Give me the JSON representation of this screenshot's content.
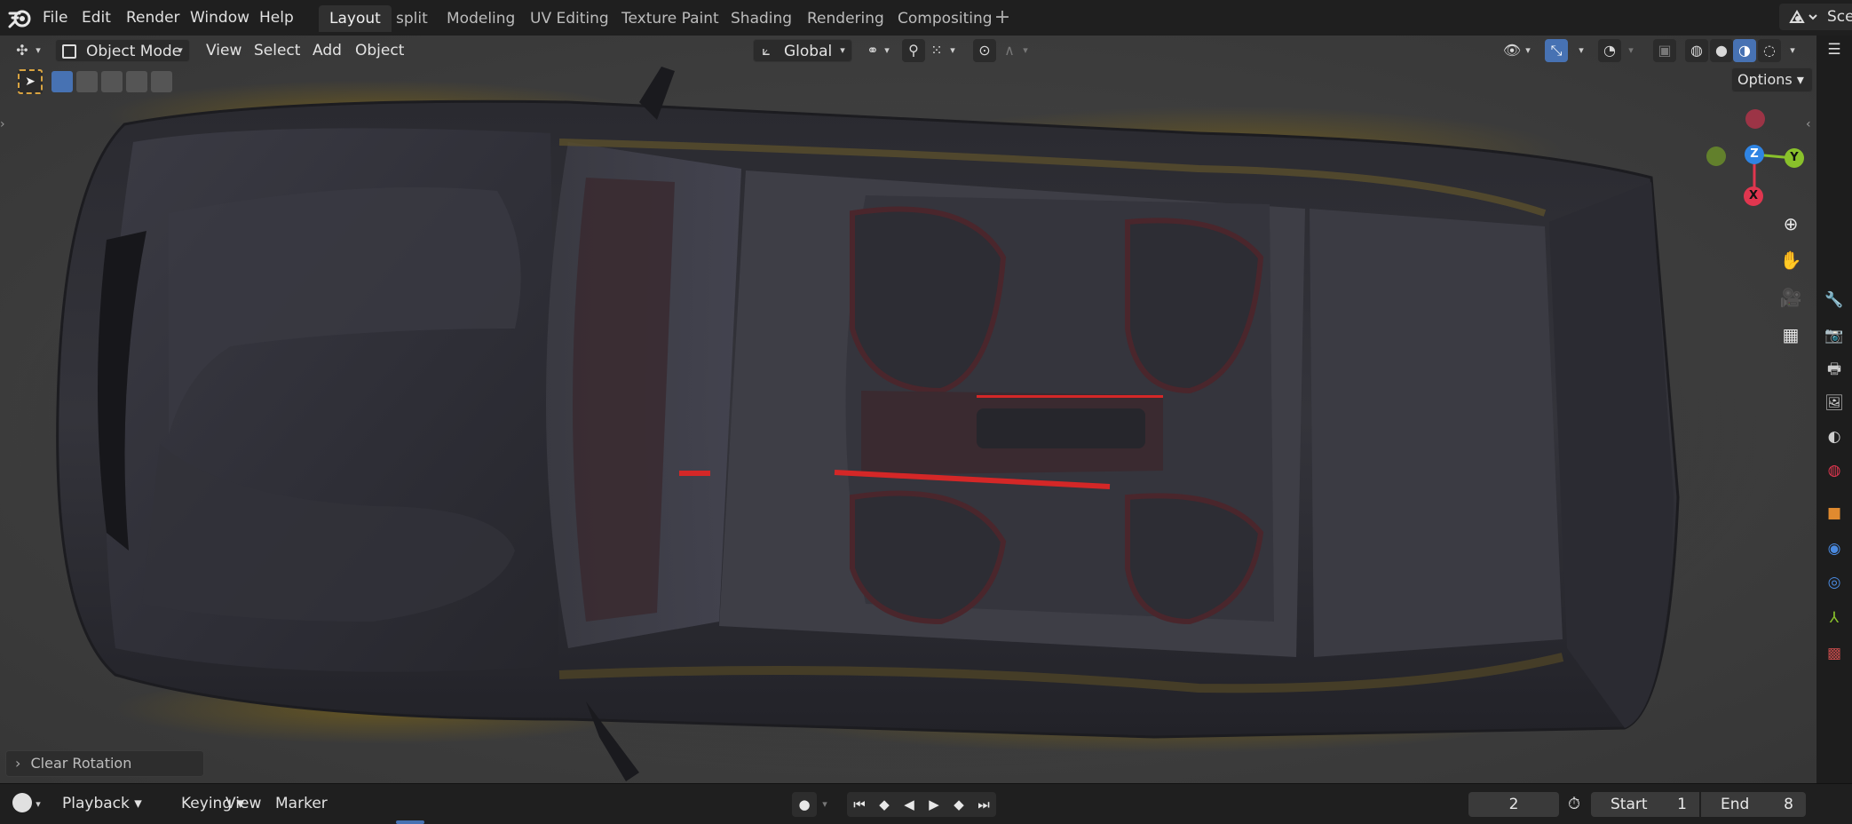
{
  "topbar": {
    "menus": [
      "File",
      "Edit",
      "Render",
      "Window",
      "Help"
    ],
    "workspaces": [
      "Layout",
      "split",
      "Modeling",
      "UV Editing",
      "Texture Paint",
      "Shading",
      "Rendering",
      "Compositing"
    ],
    "active_workspace": "Layout",
    "add_label": "+",
    "scene_label": "Sce"
  },
  "viewport_header": {
    "mode": "Object Mode",
    "menus": [
      "View",
      "Select",
      "Add",
      "Object"
    ],
    "transform_orientation": "Global",
    "options_label": "Options"
  },
  "gizmo": {
    "z": "Z",
    "y": "Y",
    "x": "X"
  },
  "operator_panel": {
    "label": "Clear Rotation"
  },
  "timeline": {
    "menus": [
      "Playback",
      "Keying",
      "View",
      "Marker"
    ],
    "current_frame": "2",
    "start_label": "Start",
    "start_value": "1",
    "end_label": "End",
    "end_value": "8"
  },
  "colors": {
    "accent": "#4772b3",
    "axis_x": "#e0364f",
    "axis_y": "#89c12b",
    "axis_z": "#2f84e3"
  },
  "icons": [
    "blender-logo-icon",
    "editor-type-icon",
    "object-mode-icon",
    "transform-orientation-icon",
    "pivot-icon",
    "snap-icon",
    "proportional-edit-icon",
    "visibility-icon",
    "gizmo-icon",
    "overlay-icon",
    "xray-icon",
    "wireframe-shading-icon",
    "solid-shading-icon",
    "material-shading-icon",
    "rendered-shading-icon",
    "zoom-icon",
    "pan-hand-icon",
    "camera-icon",
    "grid-icon",
    "tool-icon",
    "render-icon",
    "output-icon",
    "view-layer-icon",
    "scene-icon",
    "world-icon",
    "object-icon",
    "modifier-icon",
    "physics-icon",
    "constraint-icon",
    "data-icon",
    "texture-icon"
  ]
}
